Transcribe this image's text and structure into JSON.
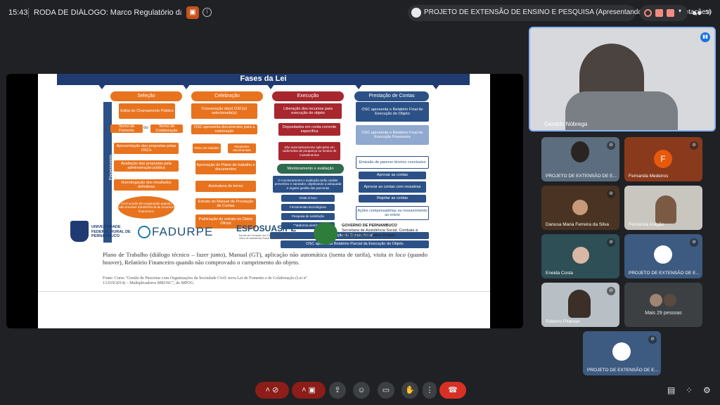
{
  "topbar": {
    "time": "15:43",
    "meeting_title": "RODA DE DIÁLOGO: Marco Regulatório da Socieda...",
    "presenting_chip": "PROJETO DE EXTENSÃO DE ENSINO E PESQUISA (Apresentando e fazendo anotações)",
    "participant_count": "39"
  },
  "slide": {
    "title": "Fases da Lei",
    "columns": [
      "Seleção",
      "Celebração",
      "Execução",
      "Prestação de Contas"
    ],
    "planning_label": "Planejamento",
    "selecao": [
      "Edital de Chamamento Público",
      "Termo de Fomento",
      "ou",
      "Termo de Colaboração",
      "Apresentação das propostas pelas OSCs",
      "Avaliação das propostas pela administração pública",
      "Homologação dos resultados definitivos",
      "Art.6 acordo de cooperação quando não envolver transferência de recursos financeiros"
    ],
    "celebracao": [
      "Convocação da(s) OSC(s) selecionada(s)",
      "OSC apresenta documentos para a celebração",
      "Plano de trabalho",
      "Requisitos documentais",
      "Aprovação do Plano de trabalho e documentos",
      "Assinatura do termo",
      "Extrato do Manual de Prestação de Contas",
      "Publicação do extrato no Diário Oficial"
    ],
    "execucao": [
      "Liberação dos recursos para execução do objeto",
      "Depositados em conta corrente específica",
      "São automaticamente aplicados em cadernetas de poupança ou fundos de investimentos",
      "Monitoramento e avaliação",
      "O monitoramento e avaliação terão caráter preventivo e saneador, objetivando a adequada e regular gestão das parcerias",
      "Visita in loco",
      "Ferramentas tecnológicas",
      "Pesquisa de satisfação",
      "Plataforma eletrônica"
    ],
    "prestacao": [
      "OSC apresenta o Relatório Final de Execução do Objeto",
      "OSC apresenta o Relatório Final de Execução Financeira",
      "Emissão de parecer técnico conclusivo",
      "Aprovar as contas",
      "Aprovar as contas com ressalvas",
      "Rejeitar as contas",
      "Ações compensatórias ou ressarcimento ao erário"
    ],
    "annual": [
      "Prestação de Contas Anual",
      "OSC apresenta Relatório Parcial da Execução do Objeto"
    ],
    "body_text_1": "Plano de Trabalho (diálogo técnico – fazer junto), Manual (GT), aplicação não automática (isenta de tarifa), visita ",
    "body_text_em": "in loco",
    "body_text_2": " (quando houver), Relatório Financeiro quando não comprovado o cumprimento do objeto.",
    "source": "Fonte: Curso \"Gestão de Parcerias com Organizações da Sociedade Civil: nova Lei de Fomento e de Colaboração (Lei nº 13.019/2014) – Multiplicadores MROSC\", do MPOG.",
    "footer": {
      "ufrpe": "UNIVERSIDADE FEDERAL RURAL DE PERNAMBUCO",
      "fadurpe": "FADURPE",
      "esfosuas": "ESFOSUAS/PE",
      "esfosuas_sub": "Escola de Formação dos Trabalhadores do Sistema Único de Assistência Social de Pernambuco",
      "gov_title": "GOVERNO DE PERNAMBUCO",
      "gov_sub": "Secretaria de Assistência Social, Combate à Fome e Políticas sobre Drogas"
    }
  },
  "participants": [
    {
      "name": "Geraldo Nóbrega"
    },
    {
      "name": "PROJETO DE EXTENSÃO DE E..."
    },
    {
      "name": "Fernanda Medeiros",
      "initial": "F"
    },
    {
      "name": "Danusa Maria Ferreira da Silva"
    },
    {
      "name": "Fernanda Aragão"
    },
    {
      "name": "Eneida Costa"
    },
    {
      "name": "PROJETO DE EXTENSÃO DE E..."
    },
    {
      "name": "Roberto Pitancar"
    },
    {
      "name": "Mais 29 pessoas"
    },
    {
      "name": "PROJETO DE EXTENSÃO DE E..."
    }
  ],
  "colors": {
    "accent_red": "#d93025",
    "tile_orange": "#8a3a1c",
    "slide_navy": "#1f3b72"
  }
}
